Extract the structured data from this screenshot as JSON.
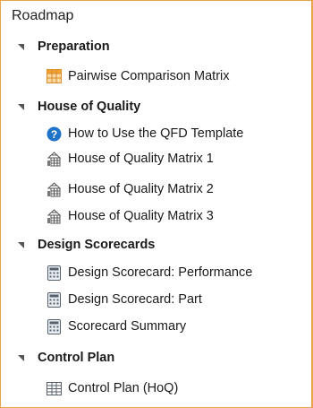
{
  "roadmap": {
    "title": "Roadmap",
    "groups": [
      {
        "label": "Preparation",
        "items": [
          {
            "label": "Pairwise Comparison Matrix",
            "icon": "matrix-grid-icon"
          }
        ]
      },
      {
        "label": "House of Quality",
        "items": [
          {
            "label": "How to Use the QFD Template",
            "icon": "help-icon"
          },
          {
            "label": "House of Quality Matrix 1",
            "icon": "house-of-quality-icon"
          },
          {
            "label": "House of Quality Matrix 2",
            "icon": "house-of-quality-icon"
          },
          {
            "label": "House of Quality Matrix 3",
            "icon": "house-of-quality-icon"
          }
        ]
      },
      {
        "label": "Design Scorecards",
        "items": [
          {
            "label": "Design Scorecard: Performance",
            "icon": "scorecard-icon"
          },
          {
            "label": "Design Scorecard: Part",
            "icon": "scorecard-icon"
          },
          {
            "label": "Scorecard Summary",
            "icon": "scorecard-icon"
          }
        ]
      },
      {
        "label": "Control Plan",
        "items": [
          {
            "label": "Control Plan (HoQ)",
            "icon": "table-grid-icon"
          }
        ]
      }
    ]
  },
  "colors": {
    "border": "#e8a44a",
    "help_blue": "#1e73c8",
    "matrix_orange": "#f0a030"
  }
}
